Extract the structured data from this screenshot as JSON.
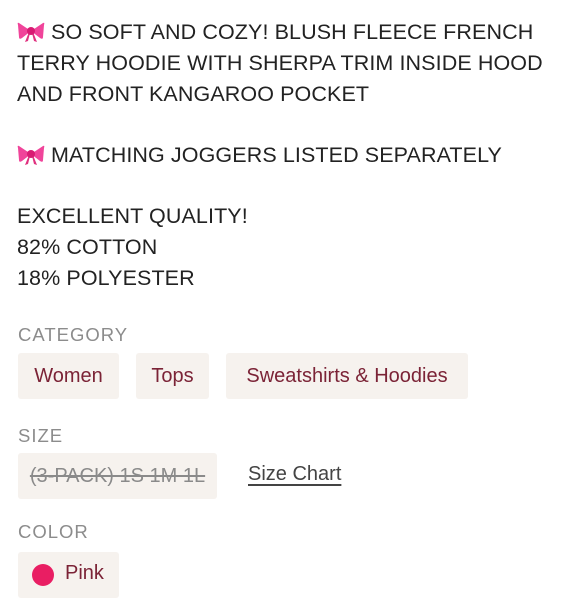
{
  "description": {
    "line1": "SO SOFT AND COZY! BLUSH FLEECE FRENCH TERRY HOODIE WITH SHERPA TRIM INSIDE HOOD AND FRONT KANGAROO POCKET",
    "line2": "MATCHING JOGGERS LISTED SEPARATELY",
    "line3": "EXCELLENT QUALITY!",
    "line4": "82% COTTON",
    "line5": "18% POLYESTER",
    "bullet_icon": "ribbon-bow-emoji"
  },
  "category": {
    "label": "CATEGORY",
    "items": [
      "Women",
      "Tops",
      "Sweatshirts & Hoodies"
    ]
  },
  "size": {
    "label": "SIZE",
    "value": "(3-PACK) 1S 1M 1L",
    "chart_link": "Size Chart"
  },
  "color": {
    "label": "COLOR",
    "value": "Pink",
    "swatch": "#e91e63"
  },
  "colors": {
    "chip_bg": "#f6f2ee",
    "chip_text": "#7b2336",
    "label_gray": "#8c8c8c"
  }
}
